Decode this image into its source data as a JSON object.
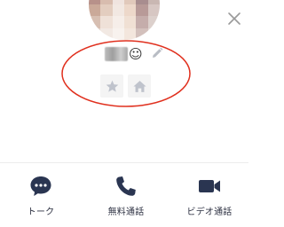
{
  "profile": {
    "avatar_colors": [
      "#c7a48f",
      "#b48d80",
      "#e6dcd8",
      "#d8c8c2",
      "#9a7f84",
      "#c6b4b0",
      "#a07c78",
      "#7f5e5e",
      "#e9d9d2",
      "#c6a394",
      "#8e6d72",
      "#d2c3c1",
      "#b7918a",
      "#d8bcae",
      "#f0e4df",
      "#e1c9bb",
      "#a88d8f",
      "#c9b7b2",
      "#caa999",
      "#e3cdbf",
      "#f2e8e2",
      "#edd8ca",
      "#b89a98",
      "#d7c7c3",
      "#d7bfb2",
      "#efe1d8",
      "#f6eee9",
      "#f0e0d4",
      "#c5adab",
      "#dcd0cc",
      "#e2d3ca",
      "#f2e9e3",
      "#f8f2ee",
      "#f3e6dd",
      "#d3c0bc",
      "#e4dad7"
    ],
    "name_suffix_emoji": "☺"
  },
  "actions": [
    {
      "label": "トーク",
      "icon": "chat-bubble-icon"
    },
    {
      "label": "無料通話",
      "icon": "phone-icon"
    },
    {
      "label": "ビデオ通話",
      "icon": "video-camera-icon"
    }
  ],
  "colors": {
    "icon_accent": "#2a3551",
    "tile_icon": "#bfc3cc",
    "tile_bg": "#f4f4f4",
    "annotation": "#e0301e"
  }
}
